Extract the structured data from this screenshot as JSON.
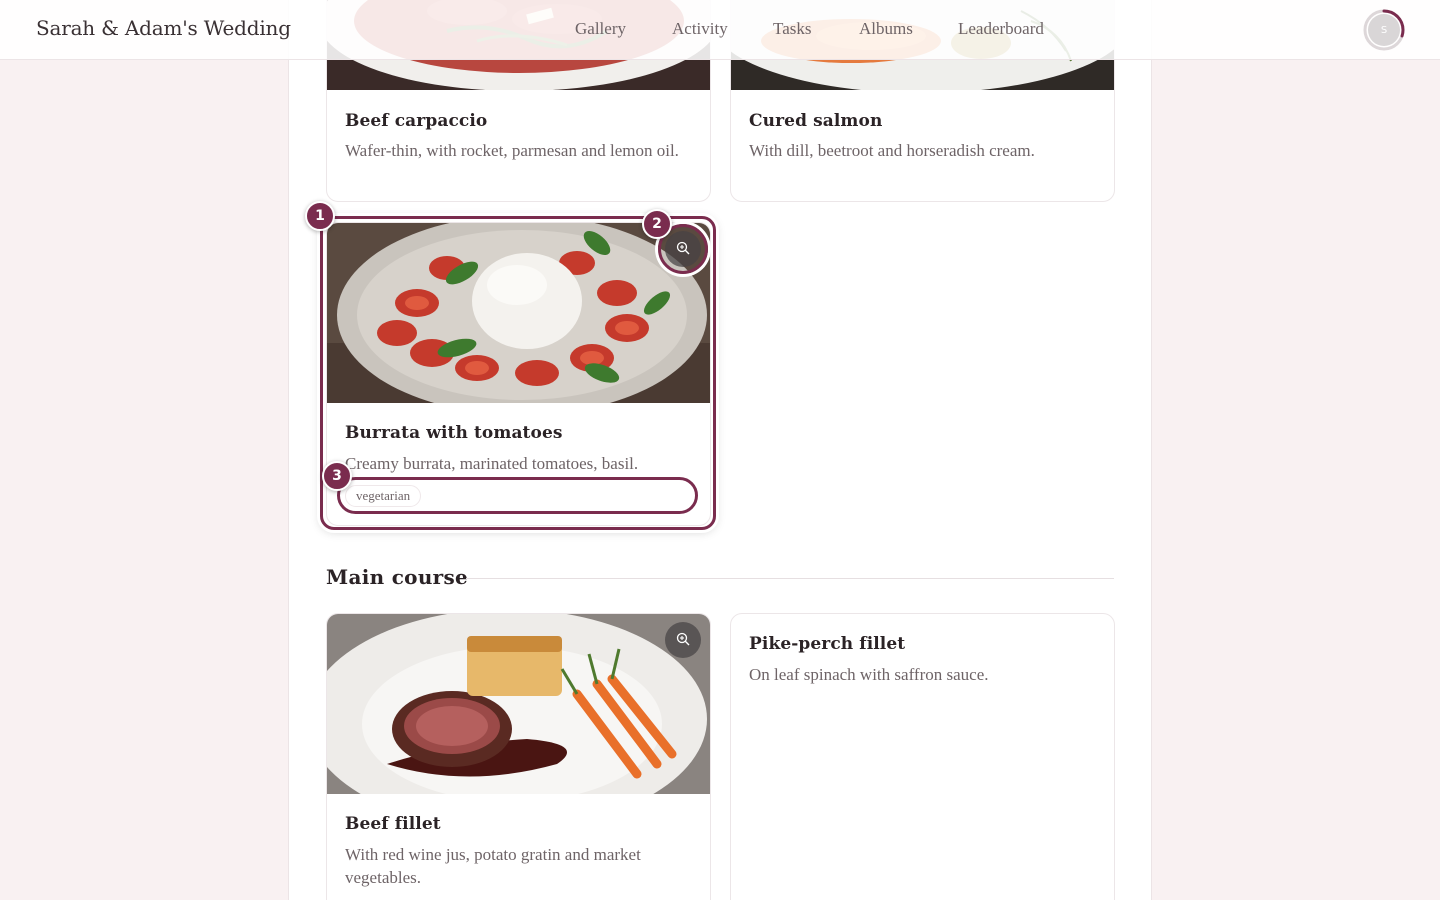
{
  "header": {
    "brand": "Sarah & Adam's Wedding",
    "nav": [
      "Gallery",
      "Activity",
      "Tasks",
      "Albums",
      "Leaderboard"
    ],
    "avatar_initial": "S",
    "progress_ring_fraction": 0.3
  },
  "menu": {
    "starters": [
      {
        "title": "Beef carpaccio",
        "description": "Wafer-thin, with rocket, parmesan and lemon oil."
      },
      {
        "title": "Cured salmon",
        "description": "With dill, beetroot and horseradish cream."
      },
      {
        "title": "Burrata with tomatoes",
        "description": "Creamy burrata, marinated tomatoes, basil.",
        "tags": [
          "vegetarian"
        ]
      }
    ],
    "main_course_heading": "Main course",
    "main_course": [
      {
        "title": "Beef fillet",
        "description": "With red wine jus, potato gratin and market vegetables."
      },
      {
        "title": "Pike-perch fillet",
        "description": "On leaf spinach with saffron sauce."
      }
    ]
  },
  "annotations": [
    "1",
    "2",
    "3"
  ],
  "colors": {
    "accent": "#7a2c4e",
    "background": "#f9f1f2",
    "text_muted": "#6e6467"
  }
}
